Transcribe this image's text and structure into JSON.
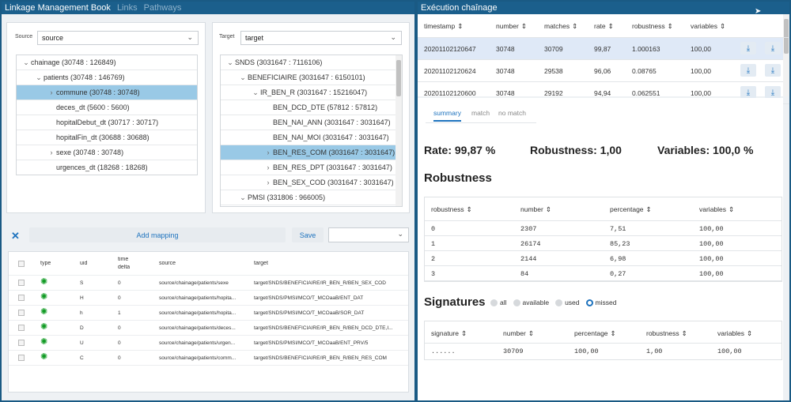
{
  "left": {
    "title": "Linkage Management Book",
    "tabs": [
      "Links",
      "Pathways"
    ],
    "source": {
      "label": "Source",
      "value": "source",
      "tree": [
        {
          "label": "chainage (30748 : 126849)",
          "arrow": "⌄",
          "level": 0,
          "selected": false
        },
        {
          "label": "patients (30748 : 146769)",
          "arrow": "⌄",
          "level": 1,
          "selected": false
        },
        {
          "label": "commune (30748 : 30748)",
          "arrow": "›",
          "level": 2,
          "selected": true
        },
        {
          "label": "deces_dt (5600 : 5600)",
          "arrow": "",
          "level": 2,
          "selected": false
        },
        {
          "label": "hopitalDebut_dt (30717 : 30717)",
          "arrow": "",
          "level": 2,
          "selected": false
        },
        {
          "label": "hopitalFin_dt (30688 : 30688)",
          "arrow": "",
          "level": 2,
          "selected": false
        },
        {
          "label": "sexe (30748 : 30748)",
          "arrow": "›",
          "level": 2,
          "selected": false
        },
        {
          "label": "urgences_dt (18268 : 18268)",
          "arrow": "",
          "level": 2,
          "selected": false
        }
      ]
    },
    "target": {
      "label": "Target",
      "value": "target",
      "tree": [
        {
          "label": "SNDS (3031647 : 7116106)",
          "arrow": "⌄",
          "level": 0,
          "selected": false
        },
        {
          "label": "BENEFICIAIRE (3031647 : 6150101)",
          "arrow": "⌄",
          "level": 1,
          "selected": false
        },
        {
          "label": "IR_BEN_R (3031647 : 15216047)",
          "arrow": "⌄",
          "level": 2,
          "selected": false
        },
        {
          "label": "BEN_DCD_DTE (57812 : 57812)",
          "arrow": "",
          "level": 3,
          "selected": false
        },
        {
          "label": "BEN_NAI_ANN (3031647 : 3031647)",
          "arrow": "",
          "level": 3,
          "selected": false
        },
        {
          "label": "BEN_NAI_MOI (3031647 : 3031647)",
          "arrow": "",
          "level": 3,
          "selected": false
        },
        {
          "label": "BEN_RES_COM (3031647 : 3031647)..",
          "arrow": "›",
          "level": 3,
          "selected": true
        },
        {
          "label": "BEN_RES_DPT (3031647 : 3031647)",
          "arrow": "›",
          "level": 3,
          "selected": false
        },
        {
          "label": "BEN_SEX_COD (3031647 : 3031647)",
          "arrow": "›",
          "level": 3,
          "selected": false
        },
        {
          "label": "PMSI (331806 : 966005)",
          "arrow": "⌄",
          "level": 1,
          "selected": false
        }
      ]
    },
    "toolbar": {
      "add_mapping": "Add mapping",
      "save": "Save",
      "close_glyph": "✕"
    },
    "mappings": {
      "headers": {
        "type": "type",
        "uid": "uid",
        "time_delta": "time",
        "time_delta2": "delta",
        "source": "source",
        "target": "target"
      },
      "rows": [
        {
          "uid": "S",
          "delta": "0",
          "source": "source/chainage/patients/sexe",
          "target": "target/SNDS/BENEFICIAIRE/IR_BEN_R/BEN_SEX_COD"
        },
        {
          "uid": "H",
          "delta": "0",
          "source": "source/chainage/patients/hopita...",
          "target": "target/SNDS/PMSI/MCO/T_MCOaaB/ENT_DAT"
        },
        {
          "uid": "h",
          "delta": "1",
          "source": "source/chainage/patients/hopita...",
          "target": "target/SNDS/PMSI/MCO/T_MCOaaB/SOR_DAT"
        },
        {
          "uid": "D",
          "delta": "0",
          "source": "source/chainage/patients/deces...",
          "target": "target/SNDS/BENEFICIAIRE/IR_BEN_R/BEN_DCD_DTE,I..."
        },
        {
          "uid": "U",
          "delta": "0",
          "source": "source/chainage/patients/urgen...",
          "target": "target/SNDS/PMSI/MCO/T_MCOaaB/ENT_PRV/5"
        },
        {
          "uid": "C",
          "delta": "0",
          "source": "source/chainage/patients/comm...",
          "target": "target/SNDS/BENEFICIAIRE/IR_BEN_R/BEN_RES_COM"
        }
      ]
    }
  },
  "right": {
    "title": "Exécution chaînage",
    "runs": {
      "headers": [
        "timestamp",
        "number",
        "matches",
        "rate",
        "robustness",
        "variables"
      ],
      "rows": [
        {
          "timestamp": "20201102120647",
          "number": "30748",
          "matches": "30709",
          "rate": "99,87",
          "robustness": "1.000163",
          "variables": "100,00",
          "selected": true
        },
        {
          "timestamp": "20201102120624",
          "number": "30748",
          "matches": "29538",
          "rate": "96,06",
          "robustness": "0.08765",
          "variables": "100,00",
          "selected": false
        },
        {
          "timestamp": "20201102120600",
          "number": "30748",
          "matches": "29192",
          "rate": "94,94",
          "robustness": "0.062551",
          "variables": "100,00",
          "selected": false
        }
      ]
    },
    "subtabs": [
      "summary",
      "match",
      "no match"
    ],
    "stats": {
      "rate": "Rate:  99,87 %",
      "robustness": "Robustness:  1,00",
      "variables": "Variables:  100,0 %"
    },
    "robustness_title": "Robustness",
    "robustness_table": {
      "headers": [
        "robustness",
        "number",
        "percentage",
        "variables"
      ],
      "rows": [
        [
          "0",
          "2307",
          "7,51",
          "100,00"
        ],
        [
          "1",
          "26174",
          "85,23",
          "100,00"
        ],
        [
          "2",
          "2144",
          "6,98",
          "100,00"
        ],
        [
          "3",
          "84",
          "0,27",
          "100,00"
        ]
      ]
    },
    "signatures_title": "Signatures",
    "signature_filters": [
      {
        "label": "all",
        "on": false
      },
      {
        "label": "available",
        "on": false
      },
      {
        "label": "used",
        "on": false
      },
      {
        "label": "missed",
        "on": true
      }
    ],
    "signatures_table": {
      "headers": [
        "signature",
        "number",
        "percentage",
        "robustness",
        "variables"
      ],
      "rows": [
        [
          "......",
          "30709",
          "100,00",
          "1,00",
          "100,00"
        ]
      ]
    }
  }
}
